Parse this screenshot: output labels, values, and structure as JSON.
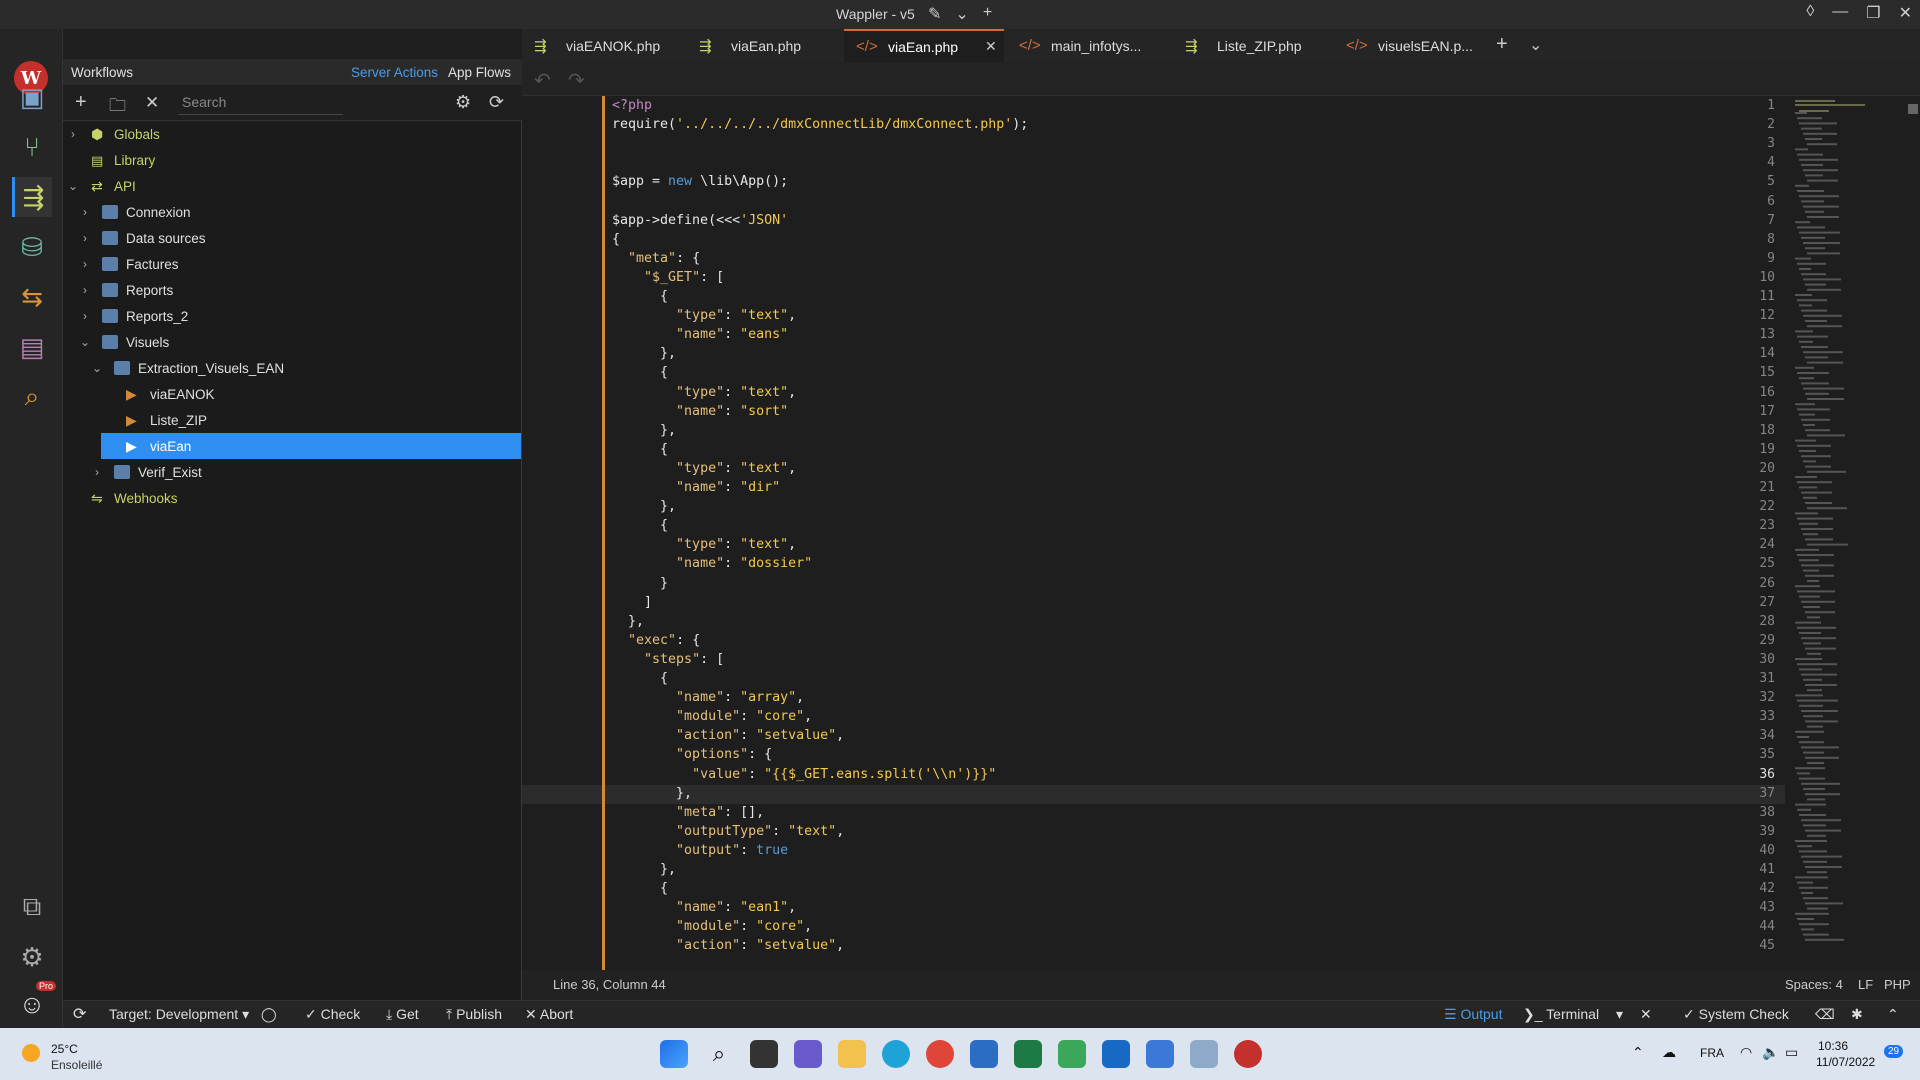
{
  "window": {
    "title": "Wappler - v5"
  },
  "sidebar": {
    "title": "Workflows",
    "server_actions": "Server Actions",
    "app_flows": "App Flows",
    "search_placeholder": "Search",
    "tree": [
      {
        "label": "Globals"
      },
      {
        "label": "Library"
      },
      {
        "label": "API"
      },
      {
        "label": "Connexion"
      },
      {
        "label": "Data sources"
      },
      {
        "label": "Factures"
      },
      {
        "label": "Reports"
      },
      {
        "label": "Reports_2"
      },
      {
        "label": "Visuels"
      },
      {
        "label": "Extraction_Visuels_EAN"
      },
      {
        "label": "viaEANOK"
      },
      {
        "label": "Liste_ZIP"
      },
      {
        "label": "viaEan"
      },
      {
        "label": "Verif_Exist"
      },
      {
        "label": "Webhooks"
      }
    ]
  },
  "tabs": [
    {
      "label": "viaEANOK.php"
    },
    {
      "label": "viaEan.php"
    },
    {
      "label": "viaEan.php"
    },
    {
      "label": "main_infotys..."
    },
    {
      "label": "Liste_ZIP.php"
    },
    {
      "label": "visuelsEAN.p..."
    }
  ],
  "editor": {
    "lines": [
      "<?php",
      "require('../../../../dmxConnectLib/dmxConnect.php');",
      "",
      "",
      "$app = new \\lib\\App();",
      "",
      "$app->define(<<<'JSON'",
      "{",
      "  \"meta\": {",
      "    \"$_GET\": [",
      "      {",
      "        \"type\": \"text\",",
      "        \"name\": \"eans\"",
      "      },",
      "      {",
      "        \"type\": \"text\",",
      "        \"name\": \"sort\"",
      "      },",
      "      {",
      "        \"type\": \"text\",",
      "        \"name\": \"dir\"",
      "      },",
      "      {",
      "        \"type\": \"text\",",
      "        \"name\": \"dossier\"",
      "      }",
      "    ]",
      "  },",
      "  \"exec\": {",
      "    \"steps\": [",
      "      {",
      "        \"name\": \"array\",",
      "        \"module\": \"core\",",
      "        \"action\": \"setvalue\",",
      "        \"options\": {",
      "          \"value\": \"{{$_GET.eans.split('\\\\n')}}\"",
      "        },",
      "        \"meta\": [],",
      "        \"outputType\": \"text\",",
      "        \"output\": true",
      "      },",
      "      {",
      "        \"name\": \"ean1\",",
      "        \"module\": \"core\",",
      "        \"action\": \"setvalue\","
    ]
  },
  "status": {
    "position": "Line 36, Column 44",
    "spaces": "Spaces: 4",
    "eol": "LF",
    "lang": "PHP"
  },
  "bottom": {
    "target": "Target: Development",
    "check": "Check",
    "get": "Get",
    "publish": "Publish",
    "abort": "Abort",
    "output": "Output",
    "terminal": "Terminal",
    "system_check": "System Check"
  },
  "taskbar": {
    "temp": "25°C",
    "weather": "Ensoleillé",
    "lang": "FRA",
    "time": "10:36",
    "date": "11/07/2022",
    "notif": "29"
  },
  "avatar_badge": "Pro",
  "colors": {
    "accent": "#2f8ff0",
    "tab_active": "#d16d3b"
  }
}
